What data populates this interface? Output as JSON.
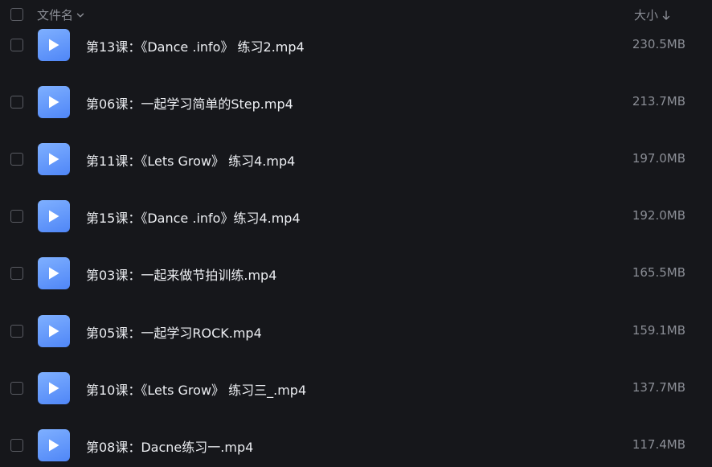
{
  "header": {
    "name_label": "文件名",
    "size_label": "大小"
  },
  "files": [
    {
      "name": "第13课：《Dance .info》 练习2.mp4",
      "size": "230.5MB"
    },
    {
      "name": "第06课：一起学习简单的Step.mp4",
      "size": "213.7MB"
    },
    {
      "name": "第11课：《Lets Grow》 练习4.mp4",
      "size": "197.0MB"
    },
    {
      "name": "第15课：《Dance .info》练习4.mp4",
      "size": "192.0MB"
    },
    {
      "name": "第03课：一起来做节拍训练.mp4",
      "size": "165.5MB"
    },
    {
      "name": "第05课：一起学习ROCK.mp4",
      "size": "159.1MB"
    },
    {
      "name": "第10课：《Lets Grow》 练习三_.mp4",
      "size": "137.7MB"
    },
    {
      "name": "第08课：Dacne练习一.mp4",
      "size": "117.4MB"
    }
  ],
  "icons": {
    "file_type": "video-play-icon",
    "sort_name": "chevron-down-icon",
    "sort_size": "arrow-down-icon"
  },
  "colors": {
    "background": "#16171b",
    "file_icon": "#5b92f9",
    "secondary_text": "#8b8e96",
    "primary_text": "#eceef2"
  }
}
